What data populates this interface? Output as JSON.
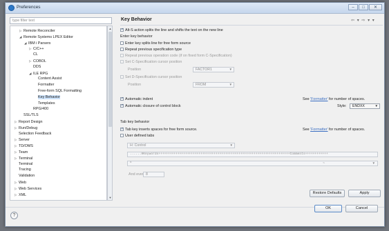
{
  "window": {
    "title": "Preferences",
    "controls": [
      "–",
      "□",
      "✕"
    ]
  },
  "filter": {
    "placeholder": "type filter text"
  },
  "tree": [
    {
      "label": "Remote Reconciler",
      "twisty": "▷",
      "indent": 1
    },
    {
      "label": "Remote Systems LPEX Editor",
      "twisty": "◢",
      "indent": 1
    },
    {
      "label": "IBM i Parsers",
      "twisty": "◢",
      "indent": 2
    },
    {
      "label": "C/C++",
      "twisty": "▷",
      "indent": 3
    },
    {
      "label": "CL",
      "twisty": "",
      "indent": 3
    },
    {
      "label": "COBOL",
      "twisty": "▷",
      "indent": 3
    },
    {
      "label": "DDS",
      "twisty": "",
      "indent": 3
    },
    {
      "label": "ILE RPG",
      "twisty": "◢",
      "indent": 3
    },
    {
      "label": "Content Assist",
      "twisty": "",
      "indent": 4
    },
    {
      "label": "Formatter",
      "twisty": "",
      "indent": 4
    },
    {
      "label": "Free-form SQL Formatting",
      "twisty": "",
      "indent": 4
    },
    {
      "label": "Key Behavior",
      "twisty": "",
      "indent": 4,
      "selected": true
    },
    {
      "label": "Templates",
      "twisty": "",
      "indent": 4
    },
    {
      "label": "RPG/400",
      "twisty": "",
      "indent": 3
    },
    {
      "label": "SSL/TLS",
      "twisty": "",
      "indent": 1
    },
    {
      "label": "Report Design",
      "twisty": "▷",
      "indent": 0
    },
    {
      "label": "Run/Debug",
      "twisty": "▷",
      "indent": 0
    },
    {
      "label": "Selection Feedback",
      "twisty": "",
      "indent": 0
    },
    {
      "label": "Server",
      "twisty": "▷",
      "indent": 0
    },
    {
      "label": "TD/OMS",
      "twisty": "▷",
      "indent": 0
    },
    {
      "label": "Team",
      "twisty": "▷",
      "indent": 0
    },
    {
      "label": "Terminal",
      "twisty": "▷",
      "indent": 0
    },
    {
      "label": "Terminal",
      "twisty": "",
      "indent": 0
    },
    {
      "label": "Tracing",
      "twisty": "",
      "indent": 0
    },
    {
      "label": "Validation",
      "twisty": "",
      "indent": 0
    },
    {
      "label": "Web",
      "twisty": "▷",
      "indent": 0
    },
    {
      "label": "Web Services",
      "twisty": "▷",
      "indent": 0
    },
    {
      "label": "XML",
      "twisty": "▷",
      "indent": 0
    }
  ],
  "page": {
    "title": "Key Behavior",
    "nav": "⇦ ▾ ⇨ ▾ ▾",
    "alt_s": "Alt-S action splits the line and shifts the text on the new line",
    "enter_section": "Enter key behavior",
    "enter_splits": "Enter key splits line for free form source",
    "repeat_prev": "Repeat previous specification type",
    "repeat_op": "Repeat previous operation code (if on fixed form C-Specification)",
    "set_c": "Set C-Specification cursor position",
    "position_label": "Position",
    "c_position_value": "FACTOR1",
    "set_d": "Set D-Specification cursor position",
    "d_position_value": "FROM",
    "auto_indent": "Automatic indent",
    "see_prefix": "See ",
    "formatter_link": "'Formatter'",
    "see_suffix": " for number of spaces.",
    "auto_close": "Automatic closure of control block",
    "style_label": "Style:",
    "style_value": "ENDXX",
    "tab_section": "Tab key behavior",
    "tab_inserts": "Tab key inserts spaces for free form source.",
    "user_tabs": "User defined tabs",
    "hspec_value": "H: Control",
    "ruler_value": "......HKeywords+++++++++++++++++++++++++++++++++++++++++++++++++++++++++++++++++++++Comments++++++++++++",
    "tabs_value": "^",
    "and_every_label": "And every:",
    "and_every_value": "8",
    "restore_defaults": "Restore Defaults",
    "apply": "Apply"
  },
  "footer": {
    "help": "?",
    "ok": "OK",
    "cancel": "Cancel"
  }
}
